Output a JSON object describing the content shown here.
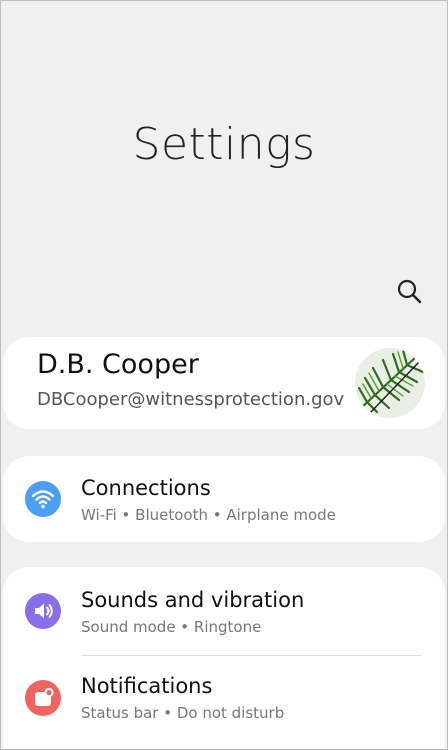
{
  "header": {
    "title": "Settings"
  },
  "account": {
    "name": "D.B. Cooper",
    "email": "DBCooper@witnessprotection.gov"
  },
  "items": [
    {
      "title": "Connections",
      "subtitle": "Wi-Fi  •  Bluetooth  •  Airplane mode",
      "icon": "wifi-icon",
      "icon_color": "#4a9ff2"
    },
    {
      "title": "Sounds and vibration",
      "subtitle": "Sound mode  •  Ringtone",
      "icon": "speaker-icon",
      "icon_color": "#8a6de8"
    },
    {
      "title": "Notifications",
      "subtitle": "Status bar  •  Do not disturb",
      "icon": "notification-icon",
      "icon_color": "#ef6461"
    }
  ],
  "colors": {
    "background": "#f0f0f0",
    "card": "#ffffff"
  }
}
